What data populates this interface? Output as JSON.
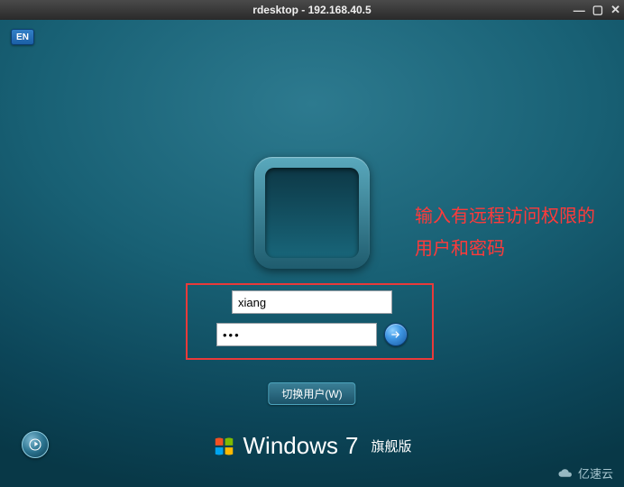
{
  "window": {
    "title": "rdesktop - 192.168.40.5"
  },
  "lang_indicator": "EN",
  "login": {
    "username_value": "xiang",
    "password_value": "•••"
  },
  "annotation": {
    "text": "输入有远程访问权限的用户和密码"
  },
  "switch_user_label": "切换用户(W)",
  "branding": {
    "product": "Windows",
    "version": "7",
    "edition": "旗舰版"
  },
  "watermark": "亿速云"
}
